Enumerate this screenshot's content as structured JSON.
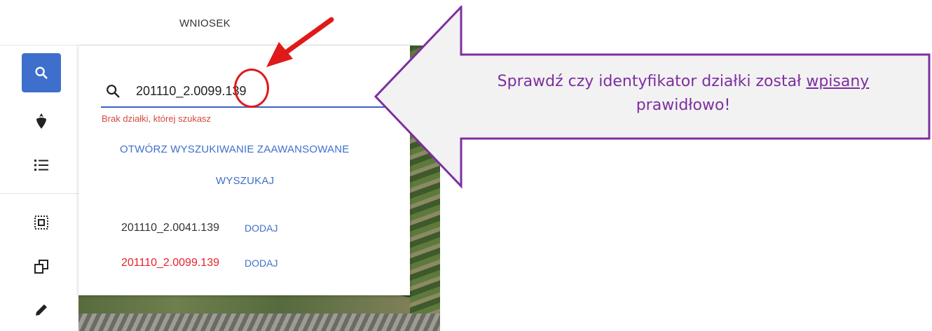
{
  "header": {
    "title": "WNIOSEK"
  },
  "sidebar": {
    "items": [
      {
        "icon": "search-icon"
      },
      {
        "icon": "beet-icon"
      },
      {
        "icon": "list-icon"
      },
      {
        "icon": "select-area-icon"
      },
      {
        "icon": "copy-icon"
      },
      {
        "icon": "pencil-icon"
      }
    ]
  },
  "search": {
    "value": "201110_2.0099.139",
    "error": "Brak działki, której szukasz",
    "advanced_label": "OTWÓRZ WYSZUKIWANIE ZAAWANSOWANE",
    "search_label": "WYSZUKAJ"
  },
  "results": [
    {
      "id": "201110_2.0041.139",
      "add_label": "DODAJ",
      "color": "#333333"
    },
    {
      "id": "201110_2.0099.139",
      "add_label": "DODAJ",
      "color": "#e8212b"
    }
  ],
  "callout": {
    "text_before": "Sprawdź czy identyfikator działki został ",
    "text_underlined": "wpisany",
    "text_after": "prawidłowo!",
    "text_color": "#7d2fa0",
    "border_color": "#7d2fa0",
    "fill_color": "#f2f2f2"
  },
  "colors": {
    "accent": "#3f6fcc",
    "error": "#d24b3e",
    "annotation_red": "#e01919"
  }
}
